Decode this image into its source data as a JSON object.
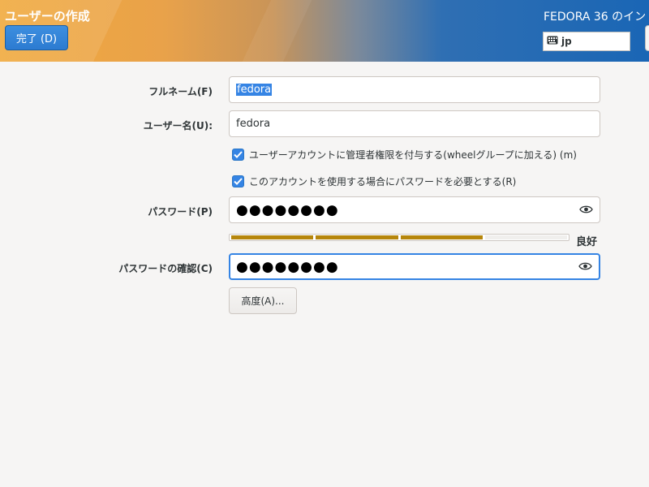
{
  "header": {
    "title": "ユーザーの作成",
    "done_label": "完了 (D)",
    "product_title": "FEDORA 36 のイン",
    "keyboard_layout": "jp"
  },
  "form": {
    "fullname_label": "フルネーム(F)",
    "fullname_value": "fedora",
    "username_label": "ユーザー名(U):",
    "username_value": "fedora",
    "admin_check_label": "ユーザーアカウントに管理者権限を付与する(wheelグループに加える) (m)",
    "admin_checked": true,
    "require_pw_label": "このアカウントを使用する場合にパスワードを必要とする(R)",
    "require_pw_checked": true,
    "password_label": "パスワード(P)",
    "password_mask": "●●●●●●●●",
    "strength_segments_filled": 3,
    "strength_segments_total": 4,
    "strength_label": "良好",
    "confirm_label": "パスワードの確認(C)",
    "confirm_mask": "●●●●●●●●",
    "advanced_label": "高度(A)..."
  },
  "colors": {
    "accent": "#3584e4",
    "strength_fill": "#b6860b",
    "header_left": "#f0a93d",
    "header_right": "#1a66b5"
  },
  "icons": [
    "keyboard-icon",
    "eye-icon",
    "check-icon"
  ]
}
